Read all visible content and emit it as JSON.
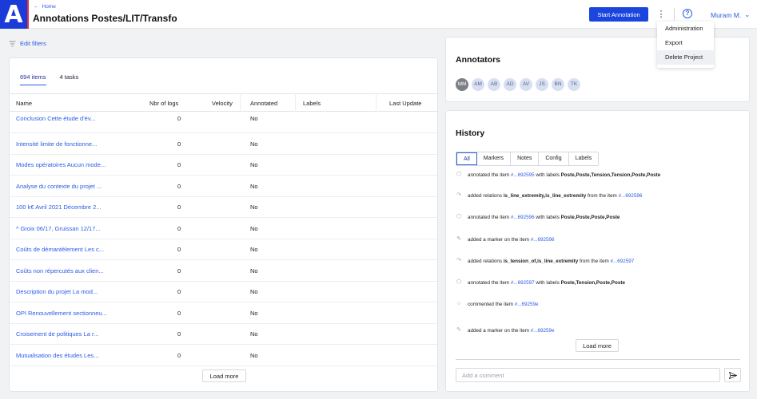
{
  "header": {
    "logo_letter": "A",
    "home_label": "Home",
    "title": "Annotations Postes/LIT/Transfo",
    "start_annotation_label": "Start Annotation",
    "user_name": "Muram M."
  },
  "project_menu": {
    "items": [
      "Administration",
      "Export",
      "Delete Project"
    ]
  },
  "filters": {
    "edit_filters_label": "Edit filters"
  },
  "items_table": {
    "tabs": [
      "694 items",
      "4 tasks"
    ],
    "columns": [
      "Name",
      "Nbr of logs",
      "Velocity",
      "Annotated",
      "Labels",
      "Last Update"
    ],
    "rows": [
      {
        "name": "Conclusion Cette étude d'év...",
        "logs": "0",
        "annotated": "No"
      },
      {
        "name": "Intensité limite de fonctionne...",
        "logs": "0",
        "annotated": "No"
      },
      {
        "name": "Modes opératoires Aucun mode...",
        "logs": "0",
        "annotated": "No"
      },
      {
        "name": "Analyse du contexte du projet ...",
        "logs": "0",
        "annotated": "No"
      },
      {
        "name": "100 k€ Avril 2021 Décembre 2...",
        "logs": "0",
        "annotated": "No"
      },
      {
        "name": "^ Groix 06/17, Gruissan 12/17...",
        "logs": "0",
        "annotated": "No"
      },
      {
        "name": "Coûts de démantèlement Les c...",
        "logs": "0",
        "annotated": "No"
      },
      {
        "name": "Coûts non répercutés aux clien...",
        "logs": "0",
        "annotated": "No"
      },
      {
        "name": "Description du projet La mod...",
        "logs": "0",
        "annotated": "No"
      },
      {
        "name": "OPI Renouvellement sectionneu...",
        "logs": "0",
        "annotated": "No"
      },
      {
        "name": "Croisement de politiques La r...",
        "logs": "0",
        "annotated": "No"
      },
      {
        "name": "Mutualisation des études Les...",
        "logs": "0",
        "annotated": "No"
      }
    ],
    "load_more_label": "Load more"
  },
  "annotators": {
    "title": "Annotators",
    "list": [
      "MM",
      "AM",
      "AB",
      "AD",
      "AV",
      "JS",
      "BN",
      "TK"
    ]
  },
  "history": {
    "title": "History",
    "filters": [
      "All",
      "Markers",
      "Notes",
      "Config",
      "Labels"
    ],
    "events": [
      {
        "icon": "tag-icon",
        "pre": "annotated the item ",
        "link": "#...692595",
        "mid": " with labels ",
        "bold": "Poste,Poste,Tension,Tension,Poste,Poste",
        "post": ""
      },
      {
        "icon": "relation-icon",
        "pre": "added relations ",
        "link": "",
        "mid": "",
        "bold": "is_line_extremity,is_line_extremity",
        "post": " from the item ",
        "link2": "#...692596"
      },
      {
        "icon": "tag-icon",
        "pre": "annotated the item ",
        "link": "#...692596",
        "mid": " with labels ",
        "bold": "Poste,Poste,Poste,Poste",
        "post": ""
      },
      {
        "icon": "marker-icon",
        "pre": "added a marker on the item ",
        "link": "#...692596",
        "mid": "",
        "bold": "",
        "post": ""
      },
      {
        "icon": "relation-icon",
        "pre": "added relations ",
        "link": "",
        "mid": "",
        "bold": "is_tension_of,is_line_extremity",
        "post": " from the item ",
        "link2": "#...692597"
      },
      {
        "icon": "tag-icon",
        "pre": "annotated the item ",
        "link": "#...692597",
        "mid": " with labels ",
        "bold": "Poste,Tension,Poste,Poste",
        "post": ""
      },
      {
        "icon": "comment-icon",
        "pre": "commented the item ",
        "link": "#...69259e",
        "mid": "",
        "bold": "",
        "post": ""
      },
      {
        "icon": "marker-icon",
        "pre": "added a marker on the item ",
        "link": "#...69259e",
        "mid": "",
        "bold": "",
        "post": ""
      }
    ],
    "load_more_label": "Load more",
    "comment_placeholder": "Add a comment"
  }
}
